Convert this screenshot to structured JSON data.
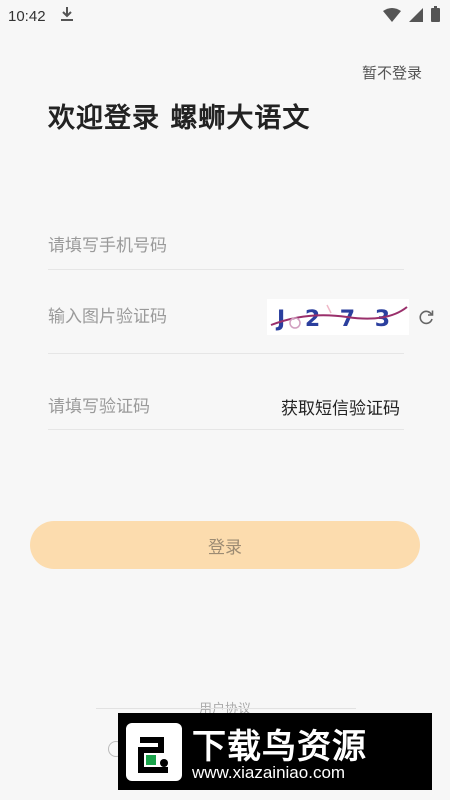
{
  "status_bar": {
    "time": "10:42",
    "icons": [
      "download-icon",
      "wifi-icon",
      "signal-icon",
      "battery-icon"
    ]
  },
  "header": {
    "skip_label": "暂不登录",
    "title": "欢迎登录 螺蛳大语文"
  },
  "form": {
    "phone_placeholder": "请填写手机号码",
    "captcha_placeholder": "输入图片验证码",
    "captcha_text": "J 2 7 3",
    "sms_placeholder": "请填写验证码",
    "sms_button_label": "获取短信验证码"
  },
  "login_button_label": "登录",
  "footer": {
    "agreement_text": "用户协议"
  },
  "watermark": {
    "title": "下载鸟资源",
    "url": "www.xiazainiao.com"
  },
  "colors": {
    "background": "#f7f7f7",
    "login_button": "#fcdcae",
    "captcha_text": "#2b3f9e"
  }
}
